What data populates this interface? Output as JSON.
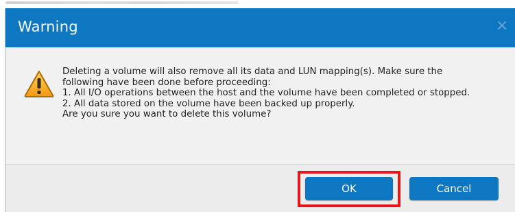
{
  "dialog": {
    "title": "Warning",
    "close_glyph": "×",
    "icon": "warning-triangle-icon",
    "message_lines": [
      "Deleting a volume will also remove all its data and LUN mapping(s). Make sure the",
      "following have been done before proceeding:",
      "1. All I/O operations between the host and the volume have been completed or stopped.",
      "2. All data stored on the volume have been backed up properly.",
      "Are you sure you want to delete this volume?"
    ],
    "ok_label": "OK",
    "cancel_label": "Cancel"
  },
  "colors": {
    "titlebar": "#0e77c1",
    "button": "#0e77c1",
    "highlight": "#e0181c",
    "warning_fill": "#f5a623"
  }
}
